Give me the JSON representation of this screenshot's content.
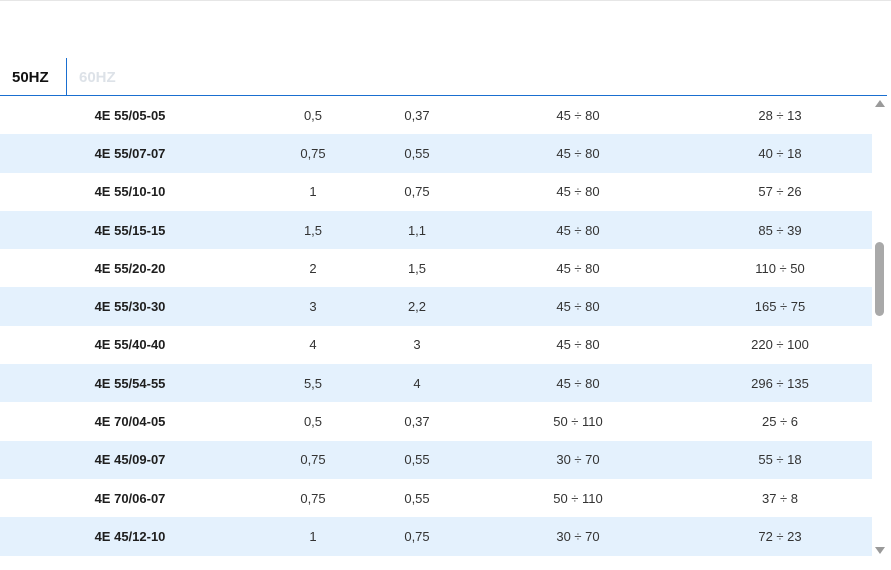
{
  "tabs": [
    {
      "label": "50HZ",
      "active": true
    },
    {
      "label": "60HZ",
      "active": false
    }
  ],
  "table": {
    "rows": [
      {
        "model": "4E 55/05-05",
        "hp": "0,5",
        "kw": "0,37",
        "flow": "45 ÷ 80",
        "head": "28 ÷ 13"
      },
      {
        "model": "4E 55/07-07",
        "hp": "0,75",
        "kw": "0,55",
        "flow": "45 ÷ 80",
        "head": "40 ÷ 18"
      },
      {
        "model": "4E 55/10-10",
        "hp": "1",
        "kw": "0,75",
        "flow": "45 ÷ 80",
        "head": "57 ÷ 26"
      },
      {
        "model": "4E 55/15-15",
        "hp": "1,5",
        "kw": "1,1",
        "flow": "45 ÷ 80",
        "head": "85 ÷ 39"
      },
      {
        "model": "4E 55/20-20",
        "hp": "2",
        "kw": "1,5",
        "flow": "45 ÷ 80",
        "head": "110 ÷ 50"
      },
      {
        "model": "4E 55/30-30",
        "hp": "3",
        "kw": "2,2",
        "flow": "45 ÷ 80",
        "head": "165 ÷ 75"
      },
      {
        "model": "4E 55/40-40",
        "hp": "4",
        "kw": "3",
        "flow": "45 ÷ 80",
        "head": "220 ÷ 100"
      },
      {
        "model": "4E 55/54-55",
        "hp": "5,5",
        "kw": "4",
        "flow": "45 ÷ 80",
        "head": "296 ÷ 135"
      },
      {
        "model": "4E 70/04-05",
        "hp": "0,5",
        "kw": "0,37",
        "flow": "50 ÷ 110",
        "head": "25 ÷ 6"
      },
      {
        "model": "4E 45/09-07",
        "hp": "0,75",
        "kw": "0,55",
        "flow": "30 ÷ 70",
        "head": "55 ÷ 18"
      },
      {
        "model": "4E 70/06-07",
        "hp": "0,75",
        "kw": "0,55",
        "flow": "50 ÷ 110",
        "head": "37 ÷ 8"
      },
      {
        "model": "4E 45/12-10",
        "hp": "1",
        "kw": "0,75",
        "flow": "30 ÷ 70",
        "head": "72 ÷ 23"
      }
    ]
  },
  "colors": {
    "accent": "#1a6fd0",
    "row_stripe": "#e4f1fd",
    "inactive_tab": "#dde2e8"
  }
}
